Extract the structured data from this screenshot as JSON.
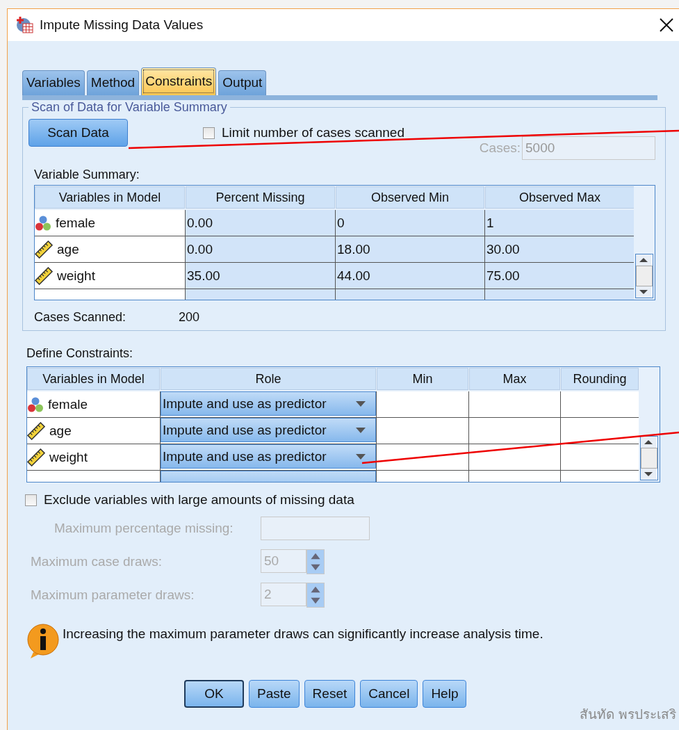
{
  "window": {
    "title": "Impute Missing Data Values"
  },
  "tabs": [
    {
      "label": "Variables",
      "selected": false
    },
    {
      "label": "Method",
      "selected": false
    },
    {
      "label": "Constraints",
      "selected": true
    },
    {
      "label": "Output",
      "selected": false
    }
  ],
  "scan_group": {
    "title": "Scan of Data for Variable Summary",
    "scan_button": "Scan Data",
    "limit_checkbox": {
      "label": "Limit number of cases scanned",
      "checked": false
    },
    "cases_field": {
      "label": "Cases:",
      "value": "5000",
      "disabled": true
    }
  },
  "summary": {
    "label": "Variable Summary:",
    "columns": [
      "Variables in Model",
      "Percent Missing",
      "Observed Min",
      "Observed Max"
    ],
    "rows": [
      {
        "variable": "female",
        "kind": "nominal",
        "cells": [
          "0.00",
          "0",
          "1"
        ]
      },
      {
        "variable": "age",
        "kind": "scale",
        "cells": [
          "0.00",
          "18.00",
          "30.00"
        ]
      },
      {
        "variable": "weight",
        "kind": "scale",
        "cells": [
          "35.00",
          "44.00",
          "75.00"
        ]
      }
    ],
    "cases_scanned": {
      "label": "Cases Scanned:",
      "value": "200"
    }
  },
  "constraints": {
    "label": "Define Constraints:",
    "columns": [
      "Variables in Model",
      "Role",
      "Min",
      "Max",
      "Rounding"
    ],
    "rows": [
      {
        "variable": "female",
        "kind": "nominal",
        "role": "Impute and use as predictor"
      },
      {
        "variable": "age",
        "kind": "scale",
        "role": "Impute and use as predictor"
      },
      {
        "variable": "weight",
        "kind": "scale",
        "role": "Impute and use as predictor"
      }
    ]
  },
  "exclude": {
    "label": "Exclude variables with large amounts of missing data",
    "checked": false,
    "field": {
      "label": "Maximum percentage missing:",
      "disabled": true
    }
  },
  "fields": [
    {
      "label": "Maximum case draws:",
      "value": "50",
      "disabled": true
    },
    {
      "label": "Maximum parameter draws:",
      "value": "2",
      "disabled": true
    }
  ],
  "info": "Increasing the maximum parameter draws can significantly increase analysis time.",
  "buttons": [
    {
      "label": "OK",
      "default": true
    },
    {
      "label": "Paste",
      "default": false
    },
    {
      "label": "Reset",
      "default": false
    },
    {
      "label": "Cancel",
      "default": false
    },
    {
      "label": "Help",
      "default": false
    }
  ],
  "credit": "สันทัด พรประเสริ"
}
